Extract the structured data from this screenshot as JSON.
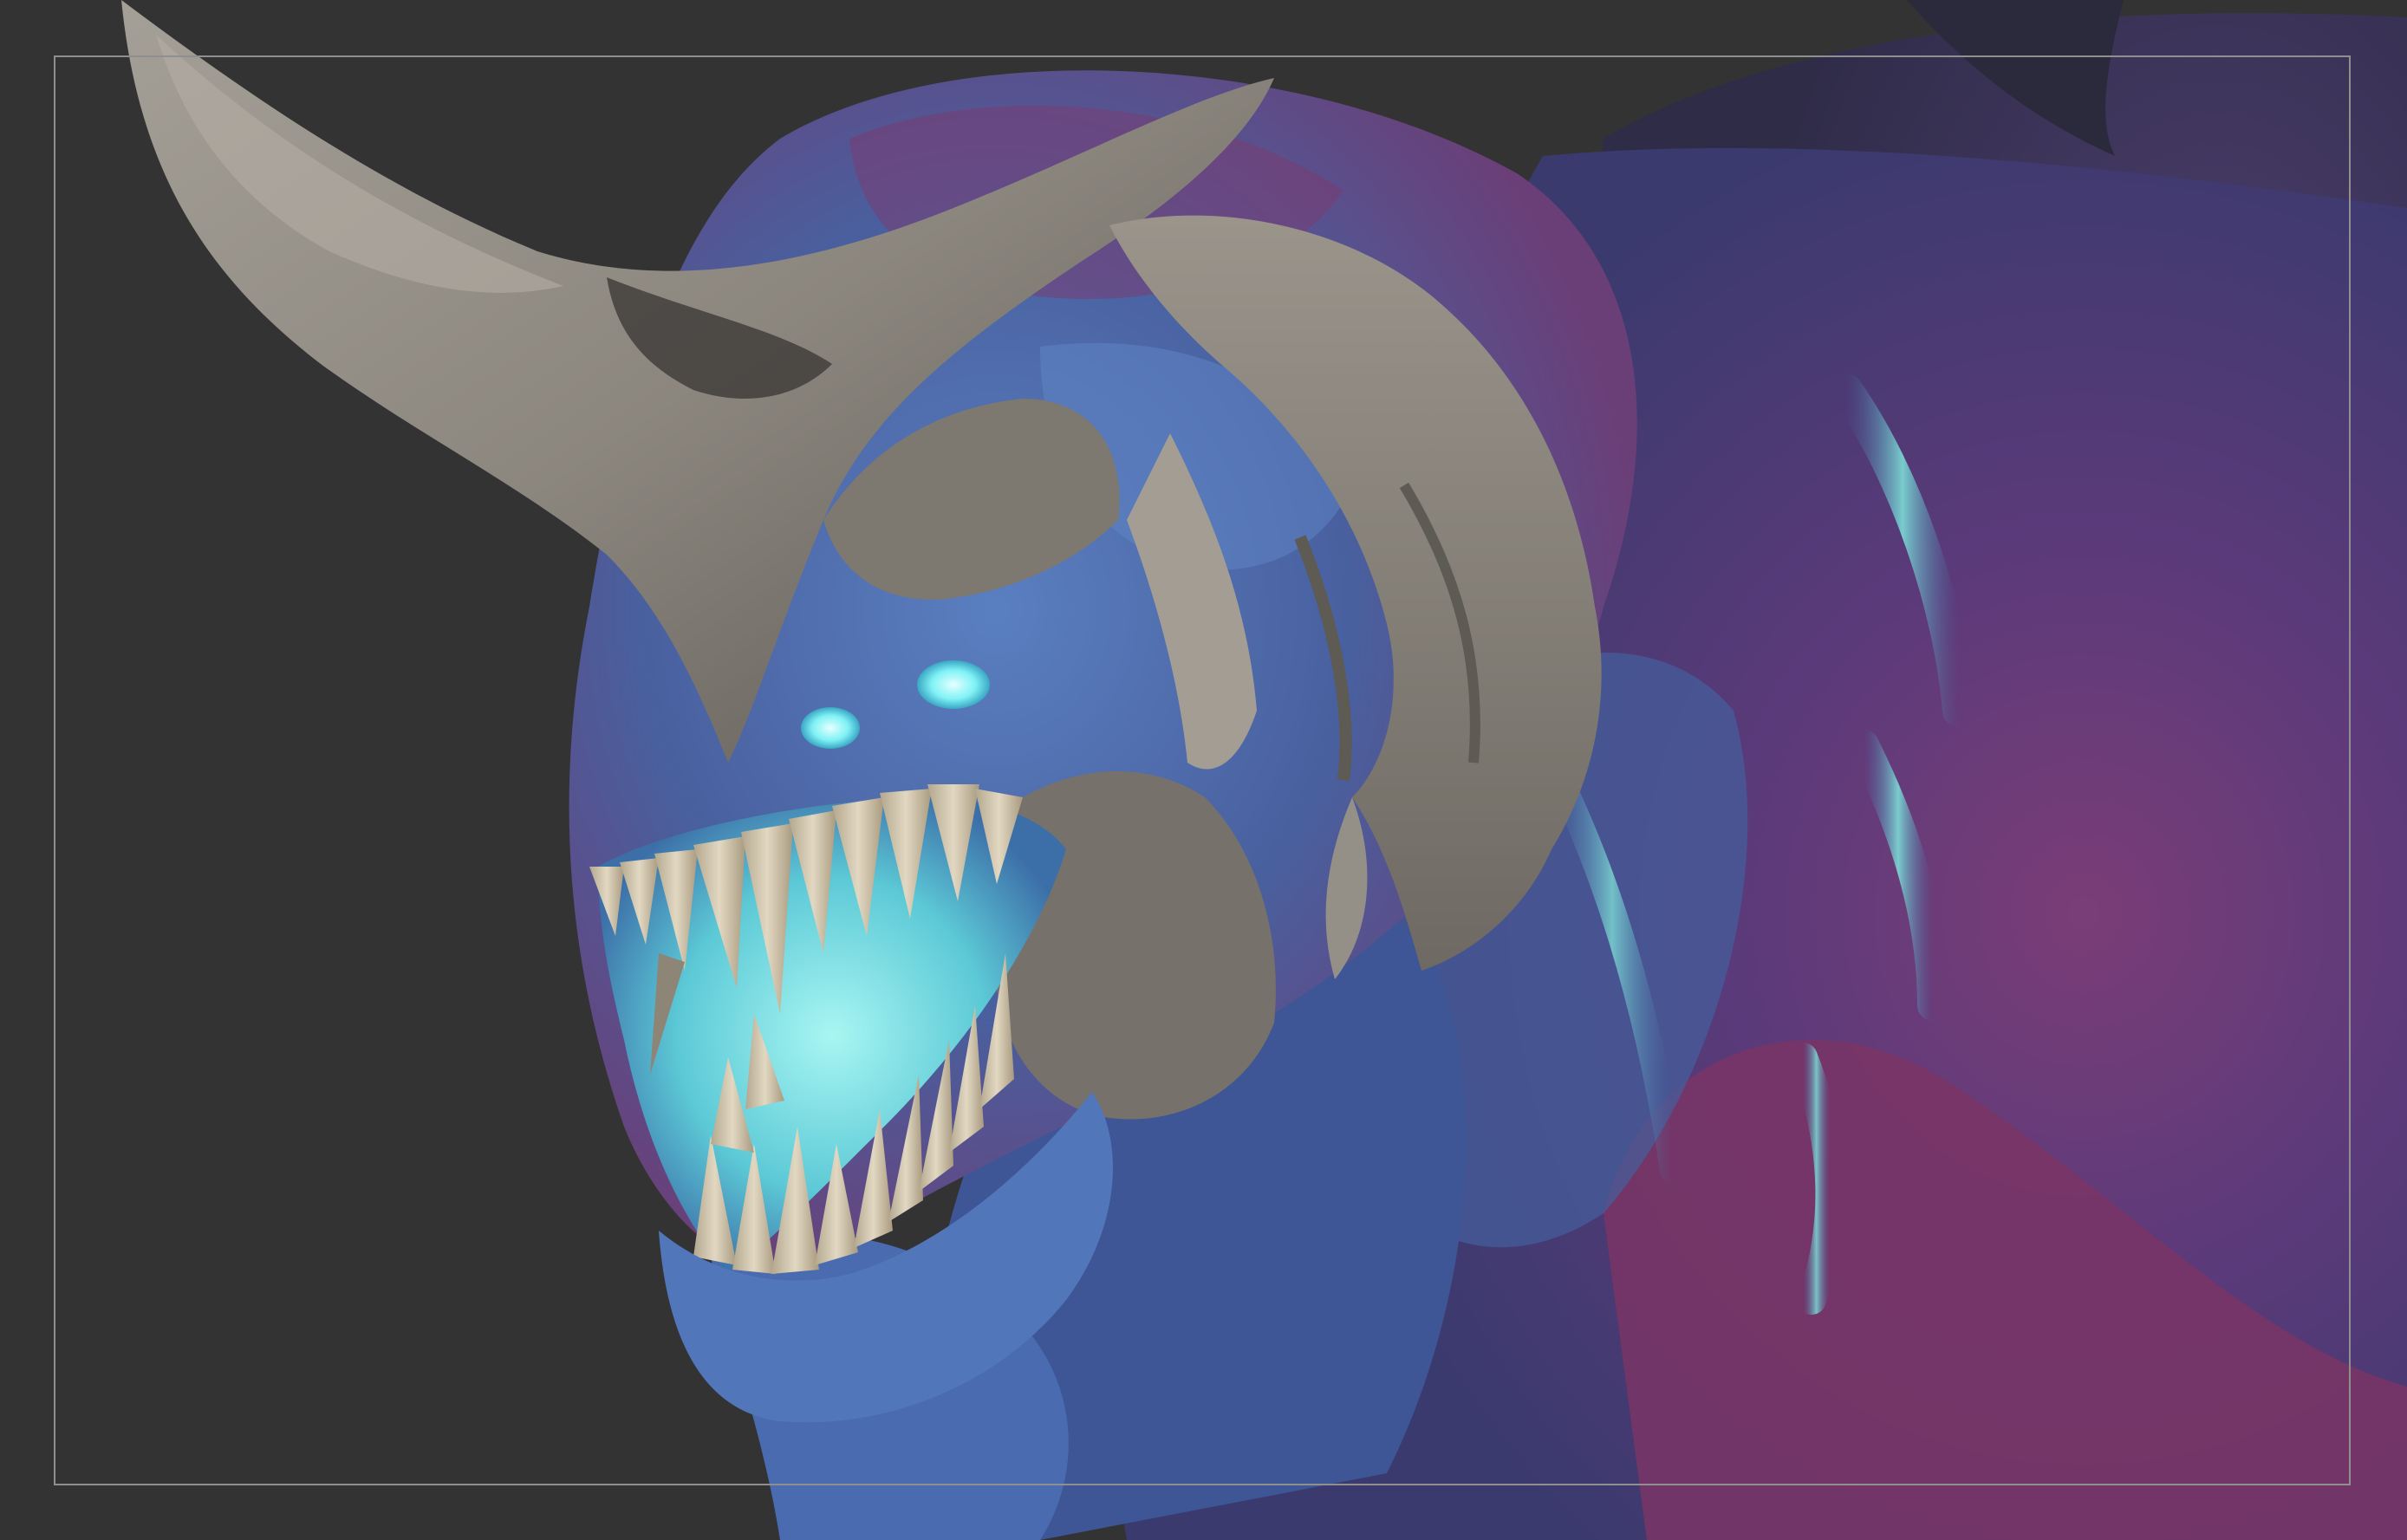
{
  "app": {
    "window_title": ""
  },
  "viewport": {
    "background_color": "#333333",
    "frame_color": "#8f8f8f",
    "model": {
      "subject": "creature-sculpt",
      "colors": {
        "horn_base": "#8f8a84",
        "horn_highlight": "#b8b2aa",
        "horn_shadow": "#4a4743",
        "skin_blue": "#3f5e9e",
        "skin_blue_light": "#5b86c6",
        "skin_magenta": "#8a3a6e",
        "skin_magenta_dark": "#5a2a55",
        "mouth_glow": "#6fe3e6",
        "eye_glow": "#7ff2f5",
        "teeth": "#d9cdb4",
        "teeth_shadow": "#a89a80"
      }
    }
  }
}
